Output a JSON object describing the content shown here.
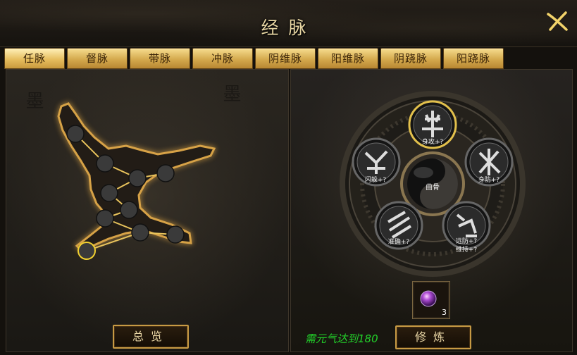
{
  "window": {
    "title": "经脉"
  },
  "tabs": [
    {
      "label": "任脉",
      "active": true
    },
    {
      "label": "督脉",
      "active": false
    },
    {
      "label": "带脉",
      "active": false
    },
    {
      "label": "冲脉",
      "active": false
    },
    {
      "label": "阴维脉",
      "active": false
    },
    {
      "label": "阳维脉",
      "active": false
    },
    {
      "label": "阴跷脉",
      "active": false
    },
    {
      "label": "阳跷脉",
      "active": false
    }
  ],
  "left_panel": {
    "overview_button": "总览"
  },
  "wheel": {
    "center_label": "曲骨",
    "skills": [
      {
        "name": "top",
        "label": "身攻+?",
        "icon": "skill-rune-icon"
      },
      {
        "name": "left",
        "label": "闪躲+?",
        "icon": "skill-rune-icon"
      },
      {
        "name": "right",
        "label": "身防+?",
        "icon": "skill-rune-icon"
      },
      {
        "name": "bottom-left",
        "label": "准确+?",
        "icon": "skill-rune-icon"
      },
      {
        "name": "bottom-right",
        "label": "远防+?",
        "label2": "维持+?",
        "icon": "skill-rune-icon"
      }
    ]
  },
  "footer": {
    "requirement_text": "需元气达到180",
    "item_count": "3",
    "cultivate_button": "修炼"
  },
  "colors": {
    "gold": "#d8b45a",
    "requirement_green": "#22d22a",
    "title_text": "#e8d6a3"
  }
}
